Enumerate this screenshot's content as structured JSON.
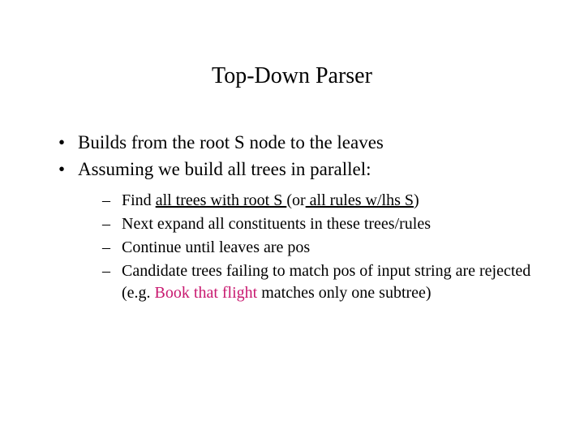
{
  "title": "Top-Down Parser",
  "bullets": {
    "b1": "Builds from the root S node to the leaves",
    "b2": "Assuming we build all trees in parallel:",
    "sub": {
      "s1a": "Find ",
      "s1b": "all trees with root S ",
      "s1c": "(or",
      "s1d": " all rules w/lhs S",
      "s1e": ")",
      "s2": "Next expand all constituents in these trees/rules",
      "s3": "Continue until leaves are pos",
      "s4a": "Candidate trees failing to match pos of input string are rejected (e.g. ",
      "s4b": "Book that flight",
      "s4c": " matches only one subtree)"
    }
  }
}
